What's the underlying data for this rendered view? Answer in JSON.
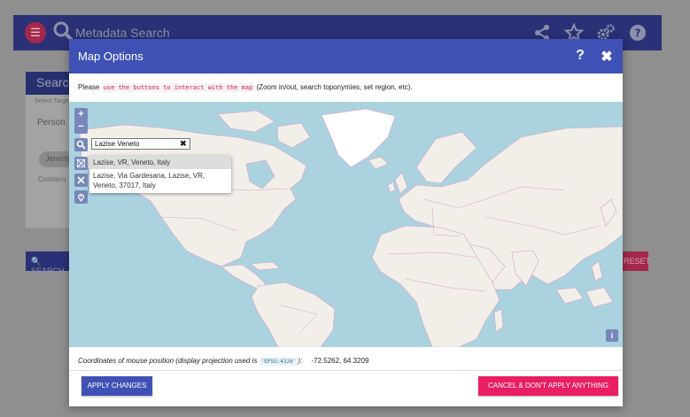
{
  "app": {
    "title": "Metadata Search",
    "menu_icon": "hamburger-menu-icon",
    "header_icons": [
      "share-icon",
      "star-icon",
      "gears-icon",
      "help-icon"
    ]
  },
  "background": {
    "panel_title": "Search",
    "select_target_label": "Select Target",
    "target_value": "Person",
    "chip_text": "Jeremy",
    "contains_label": "Contains",
    "search_button": "SEARCH",
    "reset_button": "RESET"
  },
  "modal": {
    "title": "Map Options",
    "help_label": "?",
    "close_label": "✖",
    "instructions_prefix": "Please",
    "instructions_code": "use the buttons to interact with the map",
    "instructions_suffix": "(Zoom in/out, search toponymies, set region, etc).",
    "map": {
      "zoom_in": "+",
      "zoom_out": "−",
      "search_value": "Lazise Veneto",
      "search_clear": "✖",
      "suggestions": [
        "Lazise, VR, Veneto, Italy",
        "Lazise, Via Gardesana, Lazise, VR, Veneto, 37017, Italy"
      ],
      "tool_icons": [
        "search-icon",
        "region-select-icon",
        "clear-region-icon",
        "location-pin-icon"
      ],
      "info_label": "i"
    },
    "coords_label": "Coordinates of mouse position (display projection used is",
    "coords_projection": "'EPSG:4326'",
    "coords_label_end": "):",
    "coords_value": "-72.5262, 64.3209",
    "apply_button": "APPLY CHANGES",
    "cancel_button": "CANCEL & DON'T APPLY ANYTHING"
  },
  "colors": {
    "primary": "#3f51b5",
    "accent": "#e91e63",
    "ocean": "#aad3df",
    "land": "#f2efe9",
    "ice": "#ffffff",
    "borders": "#d5a0c8"
  }
}
